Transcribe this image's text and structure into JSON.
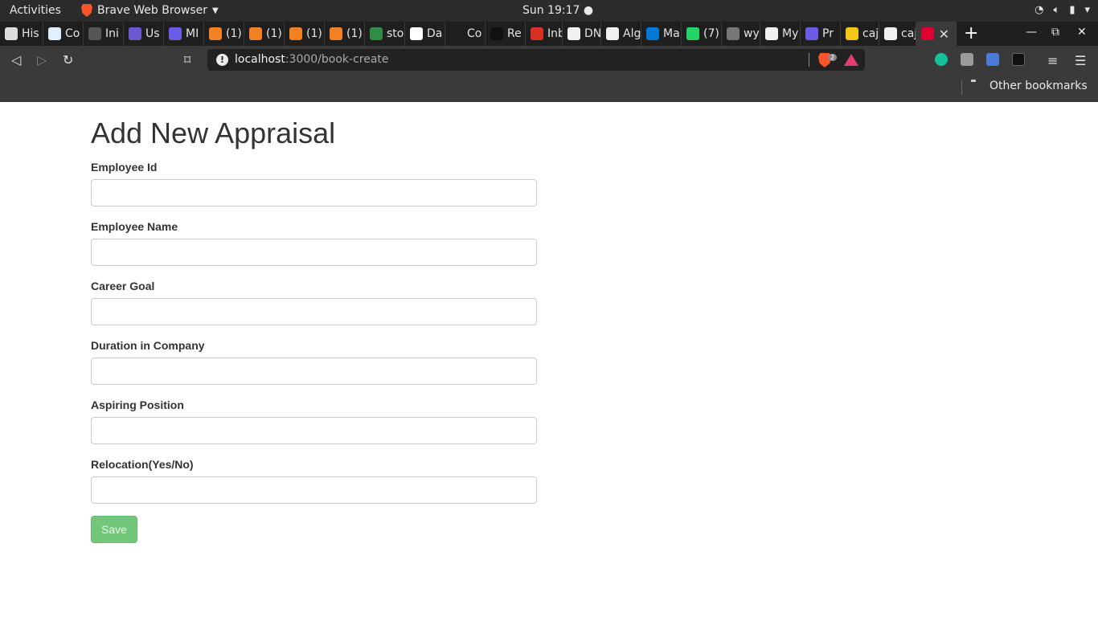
{
  "system_bar": {
    "activities": "Activities",
    "app_name": "Brave Web Browser",
    "clock": "Sun 19:17",
    "tray_icons": [
      "wifi-icon",
      "volume-icon",
      "battery-icon",
      "power-menu-icon"
    ]
  },
  "tabs": [
    {
      "label": "His",
      "icon": "history-icon",
      "color": "#dddddd"
    },
    {
      "label": "Co",
      "icon": "site-icon",
      "color": "#e0f0ff"
    },
    {
      "label": "Ini",
      "icon": "site-icon",
      "color": "#555555"
    },
    {
      "label": "Us",
      "icon": "site-icon",
      "color": "#6a5acd"
    },
    {
      "label": "MI",
      "icon": "doc-icon",
      "color": "#6b5ce7"
    },
    {
      "label": "(1)",
      "icon": "stackoverflow-icon",
      "color": "#f48024"
    },
    {
      "label": "(1)",
      "icon": "stackoverflow-icon",
      "color": "#f48024"
    },
    {
      "label": "(1)",
      "icon": "stackoverflow-icon",
      "color": "#f48024"
    },
    {
      "label": "(1)",
      "icon": "stackoverflow-icon",
      "color": "#f48024"
    },
    {
      "label": "sto",
      "icon": "geeksforgeeks-icon",
      "color": "#2f8d46"
    },
    {
      "label": "Da",
      "icon": "site-icon",
      "color": "#ffffff"
    },
    {
      "label": "Co",
      "icon": "site-icon",
      "color": "#1f1f1f"
    },
    {
      "label": "Re",
      "icon": "site-icon",
      "color": "#111111"
    },
    {
      "label": "Inb",
      "icon": "gmail-icon",
      "color": "#d93025"
    },
    {
      "label": "DN",
      "icon": "github-icon",
      "color": "#f0f0f0"
    },
    {
      "label": "Alg",
      "icon": "github-icon",
      "color": "#f0f0f0"
    },
    {
      "label": "Ma",
      "icon": "outlook-icon",
      "color": "#0078d4"
    },
    {
      "label": "(7)",
      "icon": "whatsapp-icon",
      "color": "#25d366"
    },
    {
      "label": "wy",
      "icon": "globe-icon",
      "color": "#777777"
    },
    {
      "label": "My",
      "icon": "github-icon",
      "color": "#f0f0f0"
    },
    {
      "label": "Pr",
      "icon": "doc-icon",
      "color": "#6b5ce7"
    },
    {
      "label": "caj",
      "icon": "site-icon",
      "color": "#f5c518"
    },
    {
      "label": "caj",
      "icon": "github-icon",
      "color": "#f0f0f0"
    },
    {
      "label": "",
      "icon": "angular-icon",
      "color": "#dd0031",
      "active": true
    }
  ],
  "address_bar": {
    "host": "localhost",
    "path": ":3000/book-create",
    "shields_count": "2"
  },
  "bookmarks": {
    "other": "Other bookmarks"
  },
  "form": {
    "title": "Add New Appraisal",
    "fields": [
      {
        "label": "Employee Id",
        "value": ""
      },
      {
        "label": "Employee Name",
        "value": ""
      },
      {
        "label": "Career Goal",
        "value": ""
      },
      {
        "label": "Duration in Company",
        "value": ""
      },
      {
        "label": "Aspiring Position",
        "value": ""
      },
      {
        "label": "Relocation(Yes/No)",
        "value": ""
      }
    ],
    "save_label": "Save",
    "save_color": "#72c77b"
  }
}
